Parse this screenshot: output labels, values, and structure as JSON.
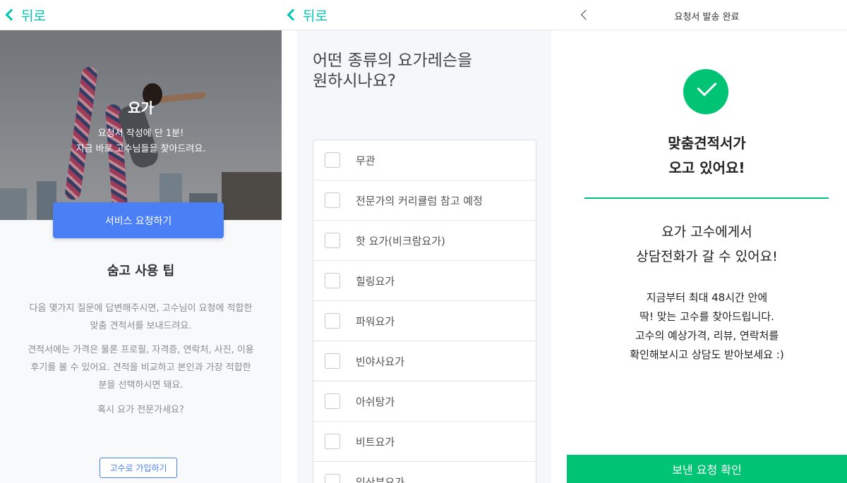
{
  "panel1": {
    "back_label": "뒤로",
    "hero": {
      "title": "요가",
      "subtitle_line1": "요청서 작성에 단 1분!",
      "subtitle_line2": "지금 바로 고수님들을 찾아드려요."
    },
    "request_button": "서비스 요청하기",
    "tips": {
      "title": "숨고 사용 팁",
      "para1_line1": "다음 몇가지 질문에 답변해주시면, 고수님이 요청에 적합한",
      "para1_line2": "맞춤 견적서를 보내드려요.",
      "para2_line1": "견적서에는 가격은 물론 프로필, 자격증, 연락처, 사진, 이용",
      "para2_line2": "후기를 볼 수 있어요. 견적을 비교하고 본인과 가장 적합한",
      "para2_line3": "분을 선택하시면 돼요.",
      "para3": "혹시 요가 전문가세요?"
    },
    "join_button": "고수로 가입하기"
  },
  "panel2": {
    "back_label": "뒤로",
    "question_line1": "어떤 종류의 요가레슨을",
    "question_line2": "원하시나요?",
    "options": [
      {
        "label": "무관",
        "checked": false
      },
      {
        "label": "전문가의 커리큘럼 참고 예정",
        "checked": false
      },
      {
        "label": "핫 요가(비크람요가)",
        "checked": false
      },
      {
        "label": "힐링요가",
        "checked": false
      },
      {
        "label": "파워요가",
        "checked": false
      },
      {
        "label": "빈야사요가",
        "checked": false
      },
      {
        "label": "아쉬탕가",
        "checked": false
      },
      {
        "label": "비트요가",
        "checked": false
      },
      {
        "label": "임산부요가",
        "checked": false
      }
    ]
  },
  "panel3": {
    "header_title": "요청서 발송 완료",
    "done_title_line1": "맞춤견적서가",
    "done_title_line2": "오고 있어요!",
    "sub_line1": "요가 고수에게서",
    "sub_line2": "상담전화가 갈 수 있어요!",
    "desc_line1": "지금부터 최대 48시간 안에",
    "desc_line2": "딱! 맞는 고수를 찾아드립니다.",
    "desc_line3": "고수의 예상가격, 리뷰, 연락처를",
    "desc_line4": "확인해보시고 상담도 받아보세요 :)",
    "confirm_button": "보낸 요청 확인"
  },
  "colors": {
    "accent_teal": "#00c7ae",
    "accent_green": "#00c473",
    "primary_blue": "#4a7ff5"
  }
}
